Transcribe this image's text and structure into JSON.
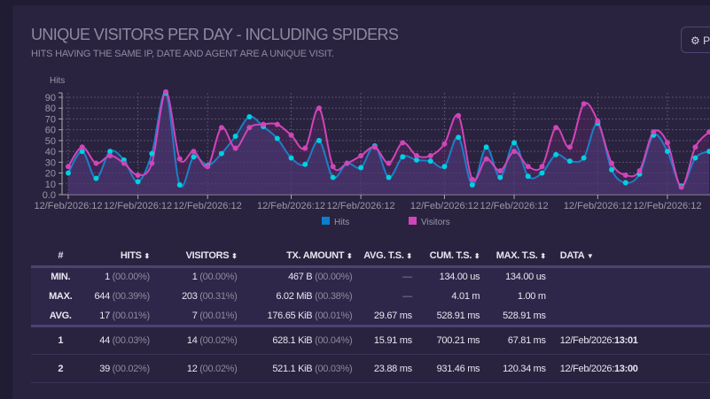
{
  "header": {
    "title": "UNIQUE VISITORS PER DAY - INCLUDING SPIDERS",
    "subtitle": "HITS HAVING THE SAME IP, DATE AND AGENT ARE A UNIQUE VISIT.",
    "panel_button": "P",
    "panel_icon": "gear-icon"
  },
  "chart_data": {
    "type": "line",
    "ylabel": "Hits",
    "ylim": [
      0,
      95
    ],
    "yticks": [
      "0.0",
      "10",
      "20",
      "30",
      "40",
      "50",
      "60",
      "70",
      "80",
      "90"
    ],
    "xtick_labels": [
      "12/Feb/2026:12",
      "12/Feb/2026:12",
      "12/Feb/2026:12",
      "12/Feb/2026:12",
      "12/Feb/2026:12",
      "12/Feb/2026:12",
      "12/Feb/2026:12",
      "12/Feb/2026:12",
      "12/Feb/2026:12"
    ],
    "xtick_indices": [
      0,
      5,
      10,
      16,
      21,
      27,
      32,
      38,
      43
    ],
    "grid": true,
    "legend": "bottom",
    "series": [
      {
        "name": "Hits",
        "color": "#1a7fc8",
        "point_color": "#00d0e0",
        "values": [
          20,
          40,
          15,
          40,
          32,
          12,
          38,
          94,
          9,
          35,
          27,
          38,
          54,
          72,
          63,
          52,
          34,
          28,
          50,
          16,
          29,
          25,
          45,
          16,
          35,
          32,
          31,
          26,
          53,
          9,
          44,
          16,
          48,
          17,
          20,
          37,
          31,
          34,
          66,
          23,
          11,
          19,
          55,
          40,
          8,
          34,
          40
        ]
      },
      {
        "name": "Visitors",
        "color": "#d045b8",
        "point_color": "#d045b8",
        "values": [
          26,
          44,
          29,
          36,
          29,
          18,
          29,
          95,
          33,
          40,
          26,
          62,
          43,
          62,
          65,
          65,
          55,
          43,
          80,
          26,
          29,
          36,
          44,
          29,
          48,
          36,
          36,
          47,
          73,
          14,
          33,
          22,
          40,
          26,
          26,
          62,
          44,
          84,
          68,
          29,
          18,
          22,
          58,
          48,
          7,
          44,
          58
        ]
      }
    ]
  },
  "table": {
    "headers": [
      "#",
      "HITS",
      "VISITORS",
      "TX. AMOUNT",
      "AVG. T.S.",
      "CUM. T.S.",
      "MAX. T.S.",
      "DATA"
    ],
    "summary": [
      {
        "label": "MIN.",
        "hits": "1",
        "hits_pct": "(00.00%)",
        "visitors": "1",
        "visitors_pct": "(00.00%)",
        "tx": "467 B",
        "tx_pct": "(00.00%)",
        "avg": "—",
        "cum": "134.00 us",
        "max": "134.00 us"
      },
      {
        "label": "MAX.",
        "hits": "644",
        "hits_pct": "(00.39%)",
        "visitors": "203",
        "visitors_pct": "(00.31%)",
        "tx": "6.02 MiB",
        "tx_pct": "(00.38%)",
        "avg": "—",
        "cum": "4.01 m",
        "max": "1.00 m"
      },
      {
        "label": "AVG.",
        "hits": "17",
        "hits_pct": "(00.01%)",
        "visitors": "7",
        "visitors_pct": "(00.01%)",
        "tx": "176.65 KiB",
        "tx_pct": "(00.01%)",
        "avg": "29.67 ms",
        "cum": "528.91 ms",
        "max": "528.91 ms"
      }
    ],
    "rows": [
      {
        "num": "1",
        "hits": "44",
        "hits_pct": "(00.03%)",
        "visitors": "14",
        "visitors_pct": "(00.02%)",
        "tx": "628.1 KiB",
        "tx_pct": "(00.04%)",
        "avg": "15.91 ms",
        "cum": "700.21 ms",
        "max": "67.81 ms",
        "date": "12/Feb/2026:",
        "time": "13:01"
      },
      {
        "num": "2",
        "hits": "39",
        "hits_pct": "(00.02%)",
        "visitors": "12",
        "visitors_pct": "(00.02%)",
        "tx": "521.1 KiB",
        "tx_pct": "(00.03%)",
        "avg": "23.88 ms",
        "cum": "931.46 ms",
        "max": "120.34 ms",
        "date": "12/Feb/2026:",
        "time": "13:00"
      }
    ]
  }
}
